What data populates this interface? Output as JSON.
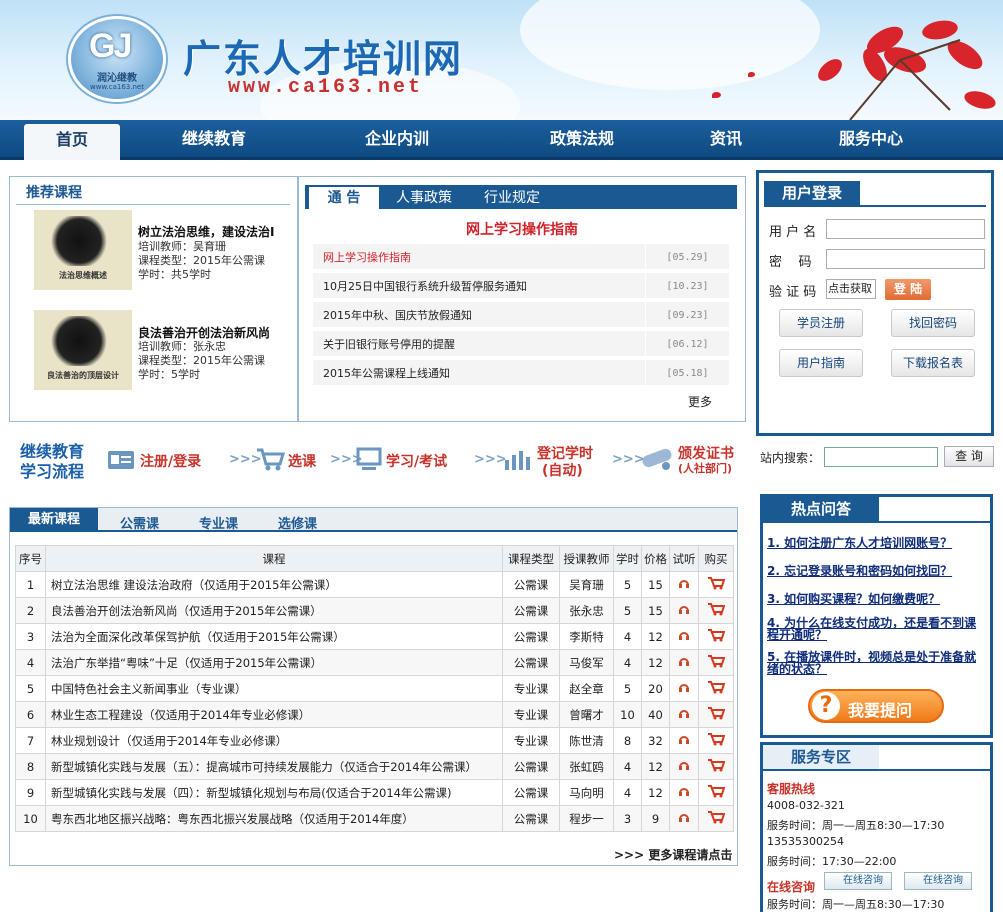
{
  "header": {
    "logo_mark": "GJ",
    "logo_name": "润沁继教",
    "logo_url": "www.ca163.net",
    "site_title": "广东人才培训网",
    "site_url": "www.ca163.net"
  },
  "nav": [
    "首页",
    "继续教育",
    "企业内训",
    "政策法规",
    "资讯",
    "服务中心"
  ],
  "recommended": {
    "title": "推荐课程",
    "items": [
      {
        "img_caption": "法治思维概述",
        "title": "树立法治思维，建设法治I",
        "teacher": "培训教师：吴育珊",
        "type": "课程类型：2015年公需课",
        "hours": "学时：共5学时"
      },
      {
        "img_caption": "良法善治的顶层设计",
        "title": "良法善治开创法治新风尚",
        "teacher": "培训教师：张永忠",
        "type": "课程类型：2015年公需课",
        "hours": "学时：5学时"
      }
    ]
  },
  "notices": {
    "tabs": [
      "通 告",
      "人事政策",
      "行业规定"
    ],
    "headline": "网上学习操作指南",
    "rows": [
      {
        "text": "网上学习操作指南",
        "date": "[05.29]",
        "highlight": true
      },
      {
        "text": "10月25日中国银行系统升级暂停服务通知",
        "date": "[10.23]",
        "highlight": false
      },
      {
        "text": "2015年中秋、国庆节放假通知",
        "date": "[09.23]",
        "highlight": false
      },
      {
        "text": "关于旧银行账号停用的提醒",
        "date": "[06.12]",
        "highlight": false
      },
      {
        "text": "2015年公需课程上线通知",
        "date": "[05.18]",
        "highlight": false
      }
    ],
    "more": "更多"
  },
  "login": {
    "title": "用户登录",
    "username_label": "用 户 名",
    "password_label": "密    码",
    "captcha_label": "验 证 码",
    "captcha_text": "点击获取",
    "login_button": "登 陆",
    "buttons": [
      "学员注册",
      "找回密码",
      "用户指南",
      "下载报名表"
    ]
  },
  "flow": {
    "title_line1": "继续教育",
    "title_line2": "学习流程",
    "steps": [
      "注册/登录",
      "选课",
      "学习/考试",
      "登记学时",
      "(自动)",
      "颁发证书",
      "(人社部门)"
    ],
    "chevron": ">>>"
  },
  "search": {
    "label": "站内搜索：",
    "button": "查 询"
  },
  "courses": {
    "tabs": [
      "最新课程",
      "公需课",
      "专业课",
      "选修课"
    ],
    "headers": [
      "序号",
      "课程",
      "课程类型",
      "授课教师",
      "学时",
      "价格",
      "试听",
      "购买"
    ],
    "rows": [
      [
        "1",
        "树立法治思维 建设法治政府（仅适用于2015年公需课）",
        "公需课",
        "吴育珊",
        "5",
        "15"
      ],
      [
        "2",
        "良法善治开创法治新风尚（仅适用于2015年公需课）",
        "公需课",
        "张永忠",
        "5",
        "15"
      ],
      [
        "3",
        "法治为全面深化改革保驾护航（仅适用于2015年公需课）",
        "公需课",
        "李斯特",
        "4",
        "12"
      ],
      [
        "4",
        "法治广东举措“粤味”十足（仅适用于2015年公需课）",
        "公需课",
        "马俊军",
        "4",
        "12"
      ],
      [
        "5",
        "中国特色社会主义新闻事业（专业课）",
        "专业课",
        "赵全章",
        "5",
        "20"
      ],
      [
        "6",
        "林业生态工程建设（仅适用于2014年专业必修课）",
        "专业课",
        "曾曙才",
        "10",
        "40"
      ],
      [
        "7",
        "林业规划设计（仅适用于2014年专业必修课）",
        "专业课",
        "陈世清",
        "8",
        "32"
      ],
      [
        "8",
        "新型城镇化实践与发展（五）：提高城市可持续发展能力（仅适合于2014年公需课）",
        "公需课",
        "张虹鸥",
        "4",
        "12"
      ],
      [
        "9",
        "新型城镇化实践与发展（四）：新型城镇化规划与布局(仅适合于2014年公需课)",
        "公需课",
        "马向明",
        "4",
        "12"
      ],
      [
        "10",
        "粤东西北地区振兴战略：粤东西北振兴发展战略（仅适用于2014年度）",
        "公需课",
        "程步一",
        "3",
        "9"
      ]
    ],
    "more": "更多课程请点击",
    "more_arrows": ">>>"
  },
  "faq": {
    "title": "热点问答",
    "items": [
      "1. 如何注册广东人才培训网账号？",
      "2. 忘记登录账号和密码如何找回？",
      "3. 如何购买课程？如何缴费呢？",
      "4. 为什么在线支付成功，还是看不到课程开通呢？",
      "5. 在播放课件时，视频总是处于准备就绪的状态？"
    ],
    "ask_button": "我要提问"
  },
  "service": {
    "title": "服务专区",
    "hotline_label": "客服热线",
    "phone1": "4008-032-321",
    "hours1": "服务时间：周一—周五8:30—17:30",
    "phone2": "13535300254",
    "hours2": "服务时间：17:30—22:00",
    "consult_label": "在线咨询",
    "consult_btn": "在线咨询",
    "hours3": "服务时间：周一—周五8:30—17:30"
  },
  "colors": {
    "nav": "#1b5f9c",
    "accent_red": "#c7332a",
    "link_blue": "#0f2d7a"
  }
}
